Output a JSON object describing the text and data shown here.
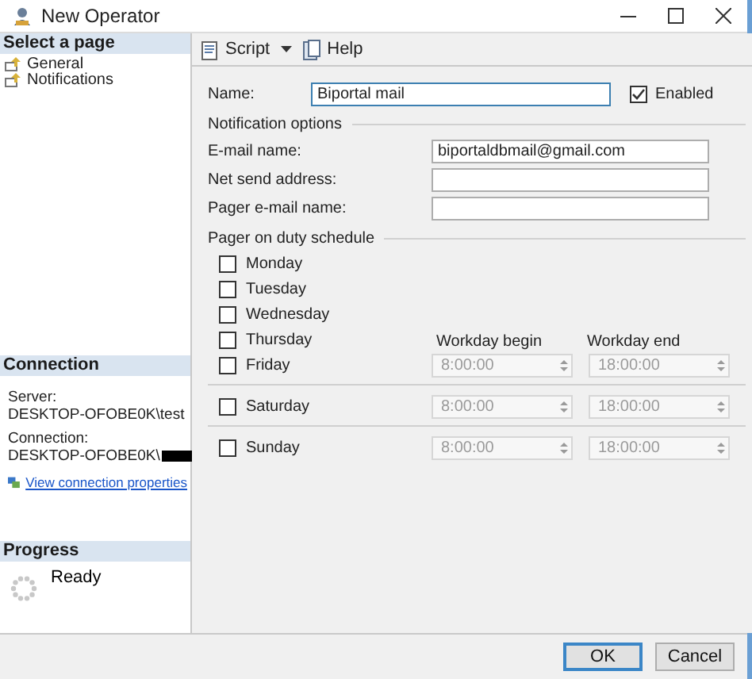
{
  "window": {
    "title": "New Operator"
  },
  "sidebar": {
    "header": "Select a page",
    "items": [
      {
        "label": "General",
        "selected": false
      },
      {
        "label": "Notifications",
        "selected": false
      }
    ]
  },
  "connection": {
    "header": "Connection",
    "server_label": "Server:",
    "server": "DESKTOP-OFOBE0K\\test",
    "connection_label": "Connection:",
    "connection": "DESKTOP-OFOBE0K\\",
    "redacted": true,
    "link": "View connection properties"
  },
  "progress": {
    "header": "Progress",
    "status": "Ready"
  },
  "toolbar": {
    "script": "Script",
    "help": "Help"
  },
  "form": {
    "name_label": "Name:",
    "name": "Biportal mail",
    "enabled": {
      "label": "Enabled",
      "checked": true
    },
    "notification_header": "Notification options",
    "fields": [
      {
        "label": "E-mail name:",
        "value": "biportaldbmail@gmail.com"
      },
      {
        "label": "Net send address:"
      },
      {
        "label": "Pager e-mail name:"
      }
    ],
    "schedule_header": "Pager on duty schedule",
    "begin_header": "Workday begin",
    "end_header": "Workday end",
    "days": [
      {
        "label": "Monday",
        "checked": false
      },
      {
        "label": "Tuesday",
        "checked": false
      },
      {
        "label": "Wednesday",
        "checked": false
      },
      {
        "label": "Thursday",
        "checked": false
      },
      {
        "label": "Friday",
        "checked": false,
        "begin": "8:00:00",
        "end": "18:00:00",
        "disabled": true
      },
      {
        "label": "Saturday",
        "checked": false,
        "begin": "8:00:00",
        "end": "18:00:00",
        "disabled": true
      },
      {
        "label": "Sunday",
        "checked": false,
        "begin": "8:00:00",
        "end": "18:00:00",
        "disabled": true
      }
    ]
  },
  "buttons": [
    "OK",
    "Cancel"
  ]
}
